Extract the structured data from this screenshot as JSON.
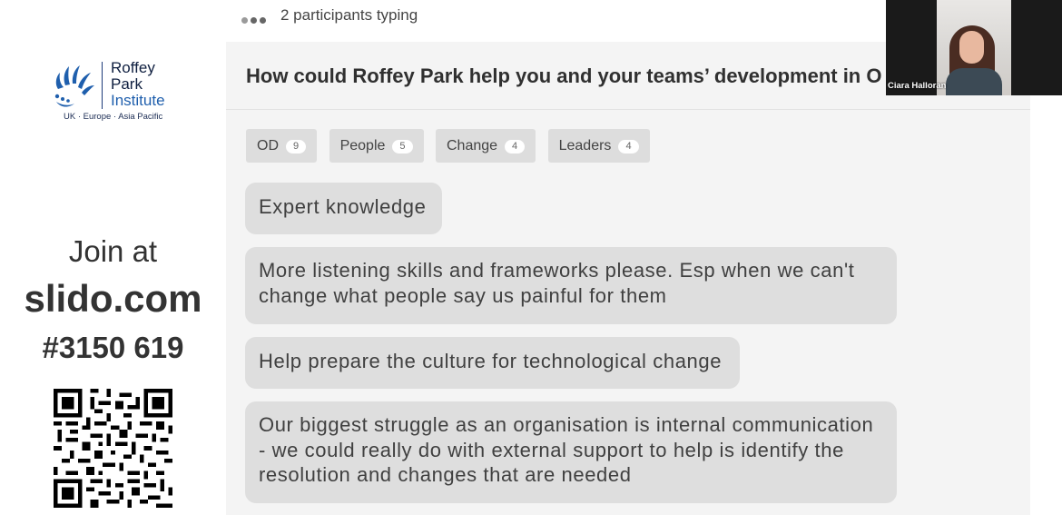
{
  "brand": {
    "logo_line1": "Roffey",
    "logo_line2": "Park",
    "logo_line3": "Institute",
    "tagline": "UK · Europe · Asia Pacific",
    "dark_blue": "#0e1e3f",
    "accent_blue": "#1f5fad"
  },
  "join": {
    "prefix": "Join at",
    "domain": "slido.com",
    "code": "#3150 619"
  },
  "typing": {
    "text": "2 participants typing"
  },
  "question": {
    "title": "How could Roffey Park help you and your teams’ development in O"
  },
  "keywords": [
    {
      "label": "OD",
      "count": "9"
    },
    {
      "label": "People",
      "count": "5"
    },
    {
      "label": "Change",
      "count": "4"
    },
    {
      "label": "Leaders",
      "count": "4"
    }
  ],
  "answers": [
    "Expert knowledge",
    "More listening skills and frameworks please. Esp when we can't change what people say us painful for them",
    "Help prepare the culture for technological change",
    "Our biggest struggle as an organisation is internal communication - we could really do with external support to help is identify the resolution and changes that are needed"
  ],
  "video": {
    "participant_name": "Ciara Halloran"
  }
}
